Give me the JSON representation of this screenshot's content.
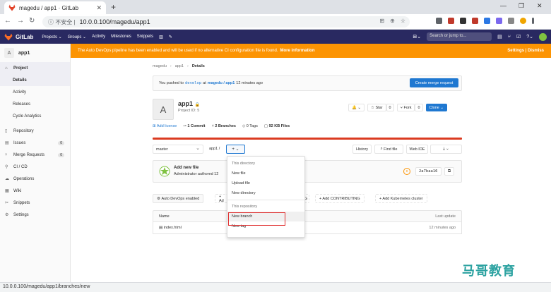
{
  "browser": {
    "tab_title": "magedu / app1 · GitLab",
    "new_tab": "+",
    "insecure_label": "不安全",
    "url": "10.0.0.100/magedu/app1",
    "status_url": "10.0.0.100/magedu/app1/branches/new",
    "colors": {
      "tabstrip": "#dee1e6"
    }
  },
  "header": {
    "brand": "GitLab",
    "nav": [
      "Projects ⌄",
      "Groups ⌄",
      "Activity",
      "Milestones",
      "Snippets"
    ],
    "search_placeholder": "Search or jump to...",
    "colors": {
      "bg": "#292961"
    }
  },
  "sidebar": {
    "project_initial": "A",
    "project_name": "app1",
    "items": [
      {
        "label": "Project",
        "icon": "home-icon",
        "active": true
      },
      {
        "label": "Repository",
        "icon": "doc-icon"
      },
      {
        "label": "Issues",
        "icon": "issues-icon",
        "badge": "0"
      },
      {
        "label": "Merge Requests",
        "icon": "merge-icon",
        "badge": "0"
      },
      {
        "label": "CI / CD",
        "icon": "rocket-icon"
      },
      {
        "label": "Operations",
        "icon": "cloud-icon"
      },
      {
        "label": "Wiki",
        "icon": "book-icon"
      },
      {
        "label": "Snippets",
        "icon": "scissors-icon"
      },
      {
        "label": "Settings",
        "icon": "gear-icon"
      }
    ],
    "subitems": [
      "Details",
      "Activity",
      "Releases",
      "Cycle Analytics"
    ]
  },
  "banner": {
    "text": "The Auto DevOps pipeline has been enabled and will be used if no alternative CI configuration file is found.",
    "more": "More information",
    "right": "Settings | Dismiss",
    "color": "#fc9403"
  },
  "breadcrumb": [
    "magedu",
    "app1",
    "Details"
  ],
  "push": {
    "prefix": "You pushed to",
    "branch": "develop",
    "at": "at",
    "project": "magedu / app1",
    "time": "12 minutes ago",
    "button": "Create merge request"
  },
  "project": {
    "initial": "A",
    "name": "app1",
    "id_label": "Project ID: 5",
    "notify": "🔔 ⌄",
    "star": "☆ Star",
    "star_count": "0",
    "fork": "⑂ Fork",
    "fork_count": "0",
    "clone": "Clone ⌄"
  },
  "stats": {
    "add_license": "Add license",
    "commits": "1 Commit",
    "branches": "2 Branches",
    "tags": "0 Tags",
    "files": "92 KB Files"
  },
  "toolbar": {
    "branch": "master",
    "path": "app1 /",
    "plus": "+ ⌄",
    "history": "History",
    "find_file": "Find file",
    "web_ide": "Web IDE",
    "download": "⤓ ⌄"
  },
  "commit": {
    "title": "Add new file",
    "meta": "Administrator authored 12",
    "status_glyph": "⏸",
    "sha": "2a7baa16",
    "copy": "⧉"
  },
  "chips": {
    "auto_devops": "Auto DevOps enabled",
    "add_prefix": "+ Ad",
    "add_ci_tail": "G",
    "contributing": "+ Add CONTRIBUTING",
    "kubernetes": "+ Add Kubernetes cluster"
  },
  "files": {
    "col_name": "Name",
    "col_update": "Last update",
    "rows": [
      {
        "name": "index.html",
        "update": "12 minutes ago"
      }
    ]
  },
  "dropdown": {
    "section1": "This directory",
    "new_file": "New file",
    "upload_file": "Upload file",
    "new_directory": "New directory",
    "section2": "This repository",
    "new_branch": "New branch",
    "new_tag": "New tag"
  },
  "watermark": "马哥教育"
}
